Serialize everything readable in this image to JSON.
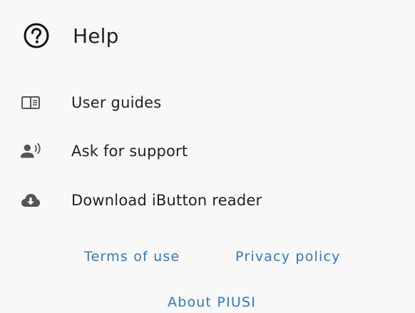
{
  "header": {
    "icon": "help-circle-icon",
    "title": "Help"
  },
  "menu": {
    "items": [
      {
        "label": "User guides",
        "icon": "book-open-icon"
      },
      {
        "label": "Ask for support",
        "icon": "support-agent-icon"
      },
      {
        "label": "Download iButton reader",
        "icon": "cloud-download-icon"
      }
    ]
  },
  "footer": {
    "terms_label": "Terms of use",
    "privacy_label": "Privacy policy",
    "about_label": "About PIUSI"
  },
  "colors": {
    "background": "#f8f8f8",
    "text": "#1f1f1f",
    "icon": "#555555",
    "link": "#2f78d0"
  }
}
